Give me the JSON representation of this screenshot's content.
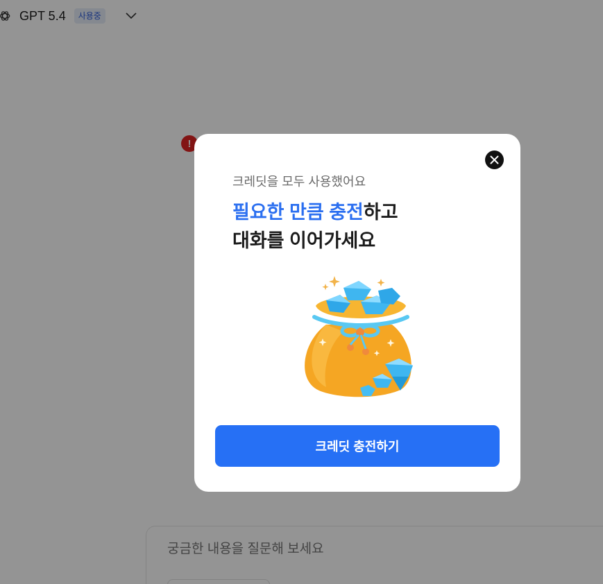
{
  "header": {
    "model_name": "GPT 5.4",
    "status_badge": "사용중",
    "model_icon": "openai-logo-icon",
    "dropdown_icon": "chevron-down-icon"
  },
  "error_indicator": {
    "icon": "exclamation-icon",
    "symbol": "!"
  },
  "composer": {
    "placeholder": "궁금한 내용을 질문해 보세요"
  },
  "modal": {
    "close_icon": "close-icon",
    "subtitle": "크레딧을 모두 사용했어요",
    "headline": {
      "accent": "필요한 만큼 충전",
      "line1_rest": "하고",
      "line2": "대화를 이어가세요"
    },
    "illustration": "money-bag-with-diamonds-illustration",
    "cta_label": "크레딧 충전하기"
  },
  "colors": {
    "accent": "#2670f5",
    "overlay": "rgba(0,0,0,0.42)",
    "error": "#e02424"
  }
}
